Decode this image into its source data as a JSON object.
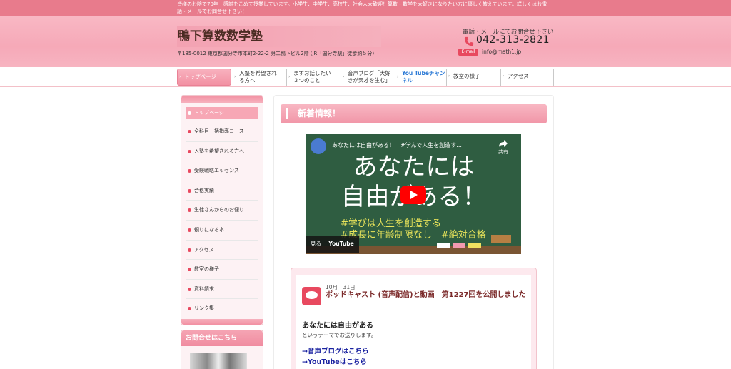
{
  "topbar": {
    "line1": "皆様のお陰で70年　感謝をこめて授業しています。小学生、中学生、高校生、社会人大歓迎！算数・数学を大好きになりたい方に優しく教えています。詳しくはお電",
    "line2": "話・メールでお問合せ下さい！"
  },
  "header": {
    "site_title": "鴨下算数数学塾",
    "address": "〒185-0012 東京都国分寺市本町2-22-2 第二鴨下ビル2階 (JR「国分寺駅」徒歩約５分)",
    "contact_label": "電話・メールにてお問合せ下さい",
    "phone": "042-313-2821",
    "email_badge": "E-mail",
    "email": "info@math1.jp"
  },
  "nav": {
    "items": [
      {
        "label": "トップページ"
      },
      {
        "line1": "入塾を希望され",
        "line2": "る方へ"
      },
      {
        "line1": "まずお話したい",
        "line2": "３つのこと"
      },
      {
        "line1": "音声ブログ「大好",
        "line2": "きが天才を生む」"
      },
      {
        "line1": "You Tubeチャン",
        "line2": "ネル"
      },
      {
        "label": "教室の様子"
      },
      {
        "label": "アクセス"
      }
    ]
  },
  "sidebar": {
    "items": [
      "トップページ",
      "全科目一括指導コース",
      "入塾を希望される方へ",
      "受験戦略エッセンス",
      "合格実績",
      "生徒さんからのお便り",
      "頼りになる本",
      "アクセス",
      "教室の様子",
      "資料請求",
      "リンク集"
    ],
    "contact_box_title": "お問合せはこちら"
  },
  "main": {
    "news_heading": "新着情報！",
    "video": {
      "title": "あなたには自由がある！　#学んで人生を創造す...",
      "share_label": "共有",
      "big_line1": "あなたには",
      "big_line2": "自由がある！",
      "tag_line1": "#学びは人生を創造する",
      "tag_line2": "#成長に年齢制限なし　#絶対合格",
      "watch_label": "見る",
      "youtube_label": "YouTube"
    },
    "post": {
      "date": "10月　31日",
      "title": "ポッドキャスト (音声配信)と動画　第1227回を公開しました",
      "subtitle": "あなたには自由がある",
      "text": "というテーマでお送りします。",
      "link1": "→音声ブログはこちら",
      "link2": "→YouTubeはこちら"
    }
  },
  "colors": {
    "topbar_bg": "#e87b8c",
    "accent_pink": "#f196a8",
    "badge_red": "#e8495f",
    "link_blue": "#1a22a0",
    "youtube_nav": "#2e7bd6"
  }
}
